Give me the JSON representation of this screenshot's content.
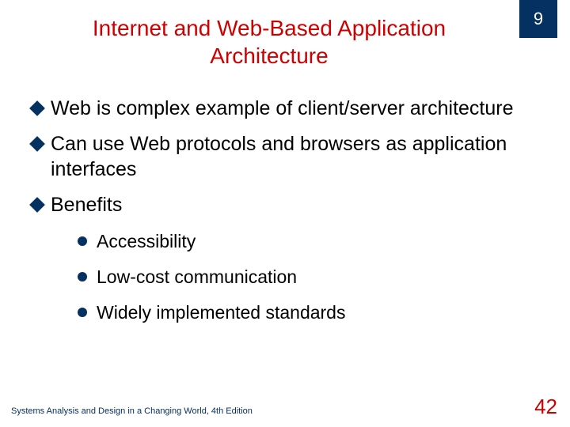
{
  "chapter_number": "9",
  "title": "Internet and Web-Based Application Architecture",
  "bullets": {
    "b0": "Web is complex example of client/server architecture",
    "b1": "Can use Web protocols and browsers as application interfaces",
    "b2": "Benefits"
  },
  "sub_bullets": {
    "s0": "Accessibility",
    "s1": "Low-cost communication",
    "s2": "Widely implemented standards"
  },
  "footer": {
    "left": "Systems Analysis and Design in a Changing World, 4th Edition",
    "page": "42"
  }
}
